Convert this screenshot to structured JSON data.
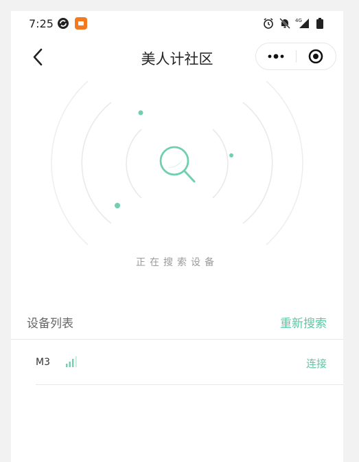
{
  "status_bar": {
    "time": "7:25",
    "icons": [
      "sync-icon",
      "app-notification-icon",
      "alarm-icon",
      "mute-icon",
      "cellular-4g-icon",
      "battery-icon"
    ],
    "network": "4G"
  },
  "nav": {
    "title": "美人计社区",
    "back_icon": "chevron-left-icon",
    "more_icon": "more-dots-icon",
    "close_icon": "target-close-icon"
  },
  "scan": {
    "status_text": "正在搜索设备",
    "icon": "magnifier-icon"
  },
  "device_list": {
    "title": "设备列表",
    "rescan_label": "重新搜索",
    "items": [
      {
        "name": "M3",
        "signal_icon": "signal-bars-icon",
        "action_label": "连接"
      }
    ]
  },
  "colors": {
    "accent": "#5ec7a5",
    "title_text": "#222222",
    "muted_text": "#9a9a9a",
    "divider": "#e8e8e8"
  }
}
